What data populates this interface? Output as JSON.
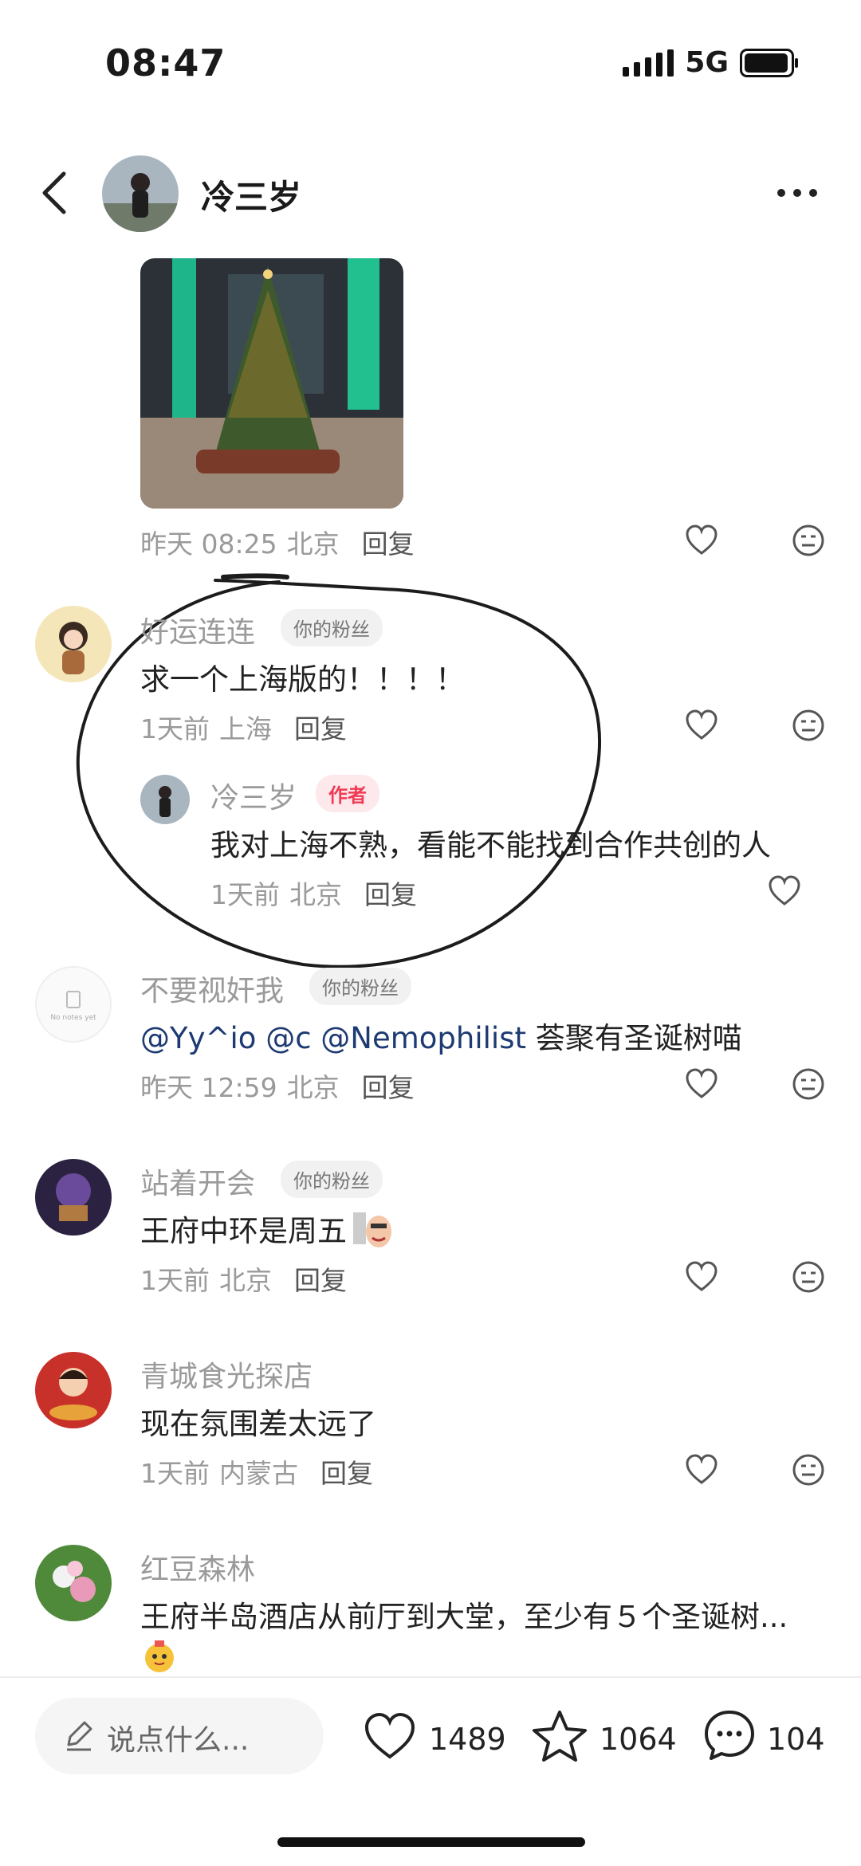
{
  "status_bar": {
    "time": "08:47",
    "network": "5G"
  },
  "header": {
    "author_name": "冷三岁"
  },
  "post": {
    "time": "昨天 08:25",
    "location": "北京",
    "reply_label": "回复"
  },
  "comments": [
    {
      "user": "好运连连",
      "tag": "你的粉丝",
      "text": "求一个上海版的！！！！",
      "time": "1天前",
      "location": "上海",
      "reply_label": "回复",
      "reply": {
        "user": "冷三岁",
        "tag": "作者",
        "text": "我对上海不熟，看能不能找到合作共创的人",
        "time": "1天前",
        "location": "北京",
        "reply_label": "回复"
      }
    },
    {
      "user": "不要视奸我",
      "tag": "你的粉丝",
      "mentions": [
        "@Yy^io",
        "@c",
        "@Nemophilist"
      ],
      "text": "荟聚有圣诞树喵",
      "time": "昨天 12:59",
      "location": "北京",
      "reply_label": "回复",
      "avatar_text": "No notes yet"
    },
    {
      "user": "站着开会",
      "tag": "你的粉丝",
      "text": "王府中环是周五",
      "time": "1天前",
      "location": "北京",
      "reply_label": "回复"
    },
    {
      "user": "青城食光探店",
      "text": "现在氛围差太远了",
      "time": "1天前",
      "location": "内蒙古",
      "reply_label": "回复"
    },
    {
      "user": "红豆森林",
      "text": "王府半岛酒店从前厅到大堂，至少有５个圣诞树..."
    }
  ],
  "bottom_bar": {
    "input_placeholder": "说点什么...",
    "like_count": "1489",
    "star_count": "1064",
    "comment_count": "104"
  },
  "colors": {
    "author_tag": "#f03b55",
    "mention": "#1d3a72"
  }
}
